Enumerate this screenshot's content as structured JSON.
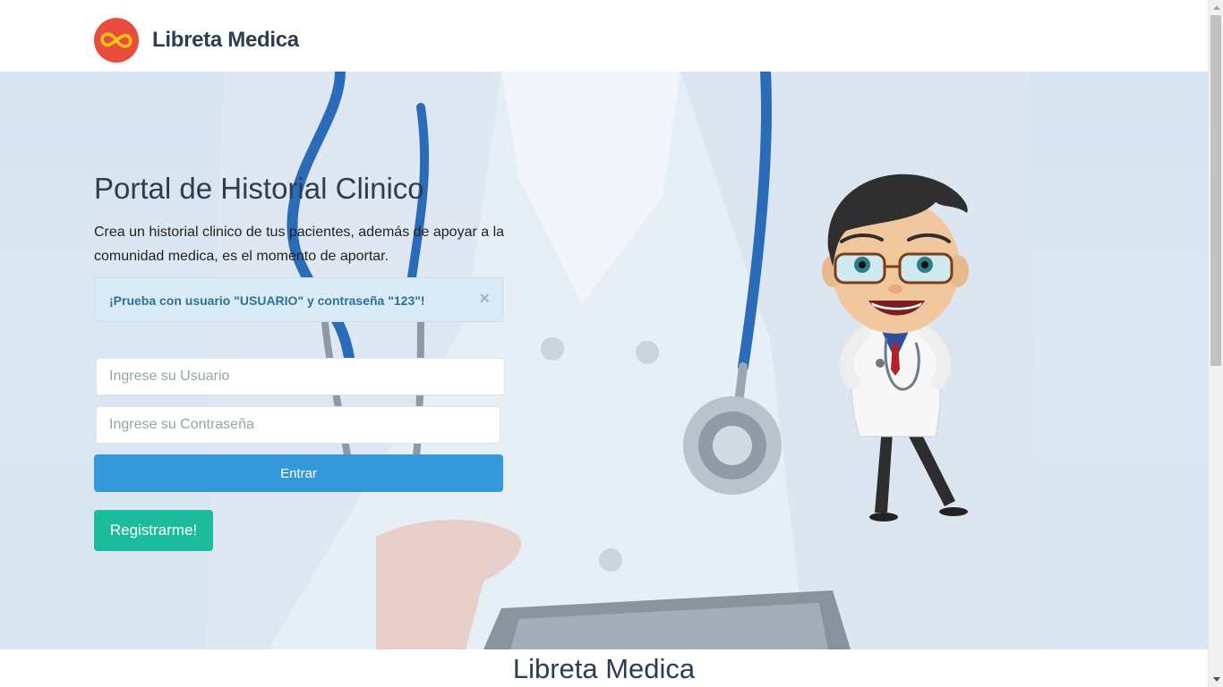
{
  "navbar": {
    "brand_name": "Libreta Medica",
    "logo_icon": "infinity-icon",
    "logo_color": "#e74c3c"
  },
  "hero": {
    "title": "Portal de Historial Clinico",
    "description": "Crea un historial clinico de tus pacientes, además de apoyar a la comunidad medica, es el momento de aportar.",
    "alert": {
      "text": "¡Prueba con usuario \"USUARIO\" y contraseña \"123\"!",
      "close_label": "×"
    },
    "form": {
      "username_placeholder": "Ingrese su Usuario",
      "password_placeholder": "Ingrese su Contraseña",
      "login_label": "Entrar",
      "register_label": "Registrarme!"
    }
  },
  "footer": {
    "text": "Libreta Medica"
  },
  "colors": {
    "primary": "#3498db",
    "success": "#1abc9c",
    "danger": "#e74c3c",
    "text": "#2c3e50",
    "alert_bg": "#d9ebf6"
  }
}
